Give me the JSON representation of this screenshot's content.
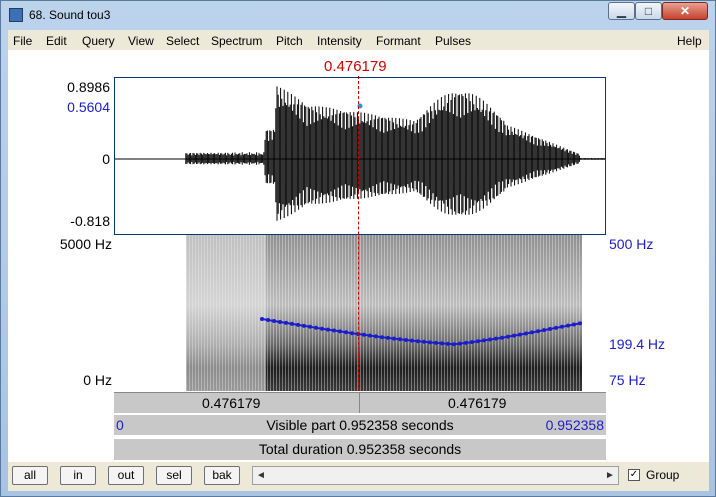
{
  "window": {
    "title": "68. Sound tou3",
    "minimize": "▁",
    "maximize": "□",
    "close": "✕"
  },
  "menu": [
    "File",
    "Edit",
    "Query",
    "View",
    "Select",
    "Spectrum",
    "Pitch",
    "Intensity",
    "Formant",
    "Pulses",
    "Help"
  ],
  "cursor": {
    "time": "0.476179"
  },
  "waveform": {
    "max_label": "0.8986",
    "cursor_value": "0.5604",
    "zero_label": "0",
    "min_label": "-0.818"
  },
  "spectrogram": {
    "top_freq": "5000 Hz",
    "bottom_freq": "0 Hz",
    "pitch_top": "500 Hz",
    "pitch_value": "199.4 Hz",
    "pitch_bottom": "75 Hz"
  },
  "time_bar": {
    "left": "0.476179",
    "right": "0.476179"
  },
  "visible": {
    "start": "0",
    "text": "Visible part 0.952358 seconds",
    "end": "0.952358"
  },
  "total": {
    "text": "Total duration 0.952358 seconds"
  },
  "controls": {
    "buttons": [
      "all",
      "in",
      "out",
      "sel",
      "bak"
    ],
    "scroll_left": "◄",
    "scroll_right": "►",
    "group_label": "Group",
    "group_checked": "✓"
  },
  "colors": {
    "cursor": "#d40000",
    "pitch": "#1c1ccf",
    "frame": "#003a7a"
  }
}
